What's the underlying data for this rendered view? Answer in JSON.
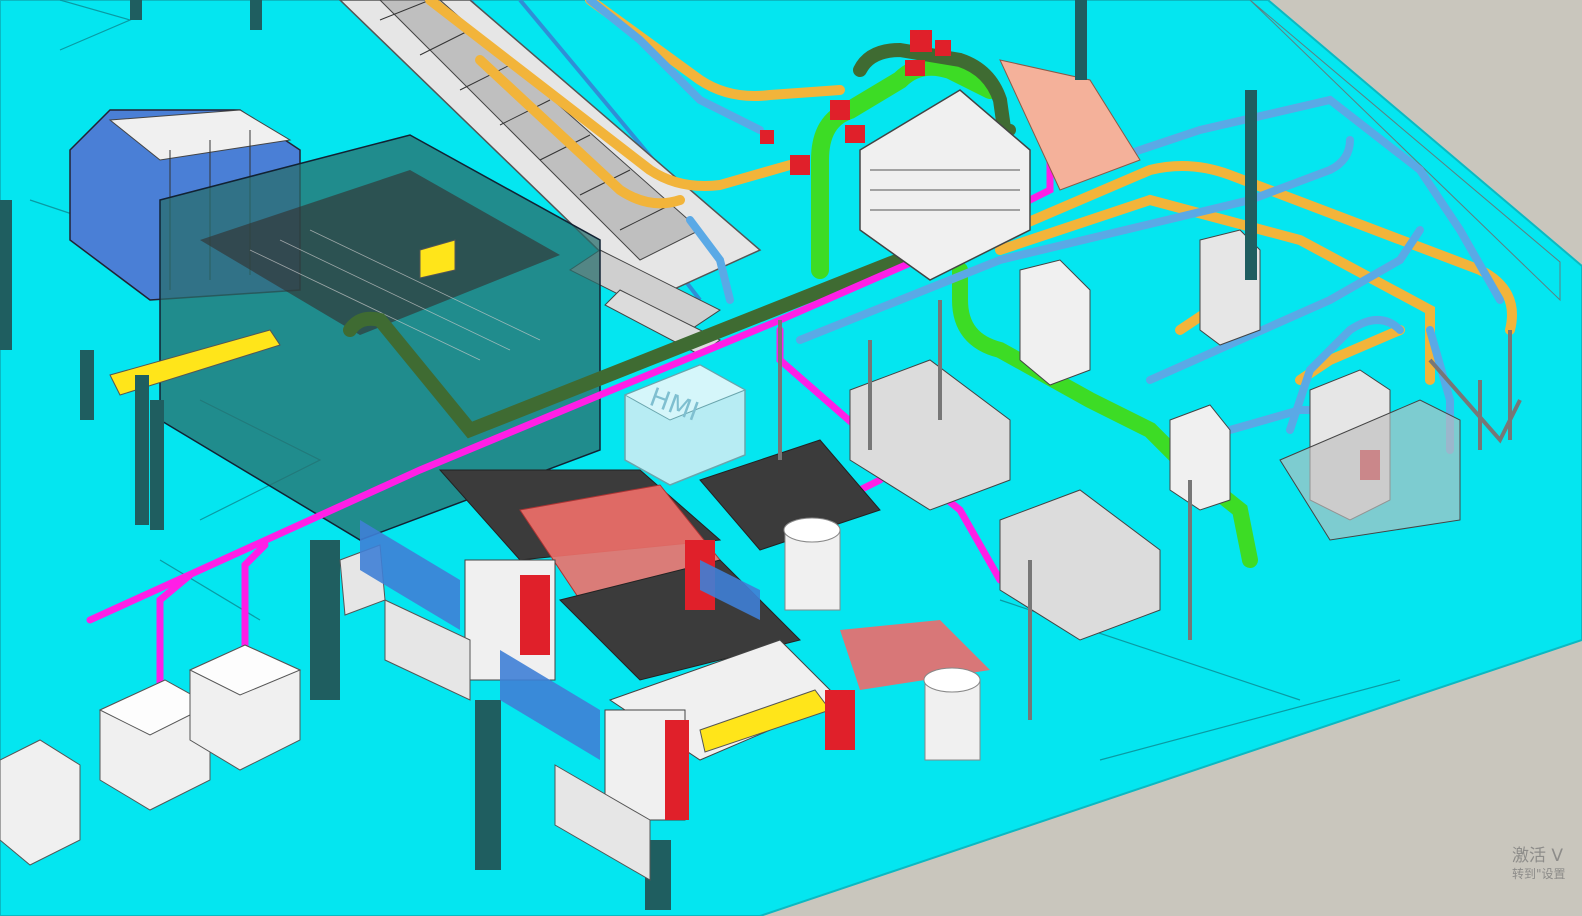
{
  "viewer": {
    "name": "3d-factory-layout-viewport",
    "box_label": "HMI"
  },
  "watermark": {
    "line1": "激活 V",
    "line2": "转到\"设置"
  },
  "colors": {
    "floor": "#04e6f0",
    "floor_edge": "#0bb9c2",
    "backdrop": "#c9c6bd",
    "pipe_orange": "#f2b43a",
    "pipe_blue": "#5aa9e6",
    "pipe_green": "#3ddc25",
    "pipe_dark_green": "#3f6b32",
    "pipe_magenta": "#ff1fe6",
    "flange_red": "#e0202a",
    "steel_gray": "#8f979c",
    "glass_enclosure": "#2a6d6c",
    "panel_white": "#f0f0f0",
    "salmon": "#f4b19a",
    "guard_yellow": "#ffe51a",
    "coil_red": "#f06a6a"
  }
}
